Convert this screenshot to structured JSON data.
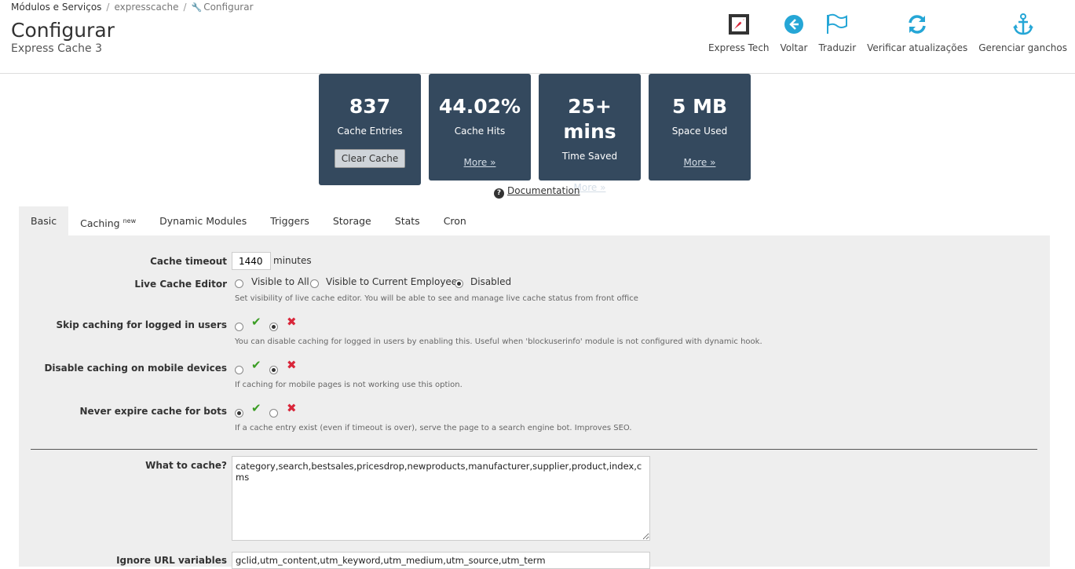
{
  "breadcrumb": {
    "first": "Módulos e Serviços",
    "second": "expresscache",
    "current": "Configurar"
  },
  "page": {
    "title": "Configurar",
    "subtitle": "Express Cache 3"
  },
  "toolbar": [
    {
      "label": "Express Tech",
      "icon": "rocket-icon"
    },
    {
      "label": "Voltar",
      "icon": "back-arrow-icon"
    },
    {
      "label": "Traduzir",
      "icon": "flag-icon"
    },
    {
      "label": "Verificar atualizações",
      "icon": "refresh-icon"
    },
    {
      "label": "Gerenciar ganchos",
      "icon": "anchor-icon"
    }
  ],
  "stats": [
    {
      "value": "837",
      "caption": "Cache Entries",
      "action": "Clear Cache"
    },
    {
      "value": "44.02%",
      "caption": "Cache Hits",
      "action": "More »"
    },
    {
      "value": "25+ mins",
      "caption": "Time Saved",
      "action": "More »"
    },
    {
      "value": "5 MB",
      "caption": "Space Used",
      "action": "More »"
    }
  ],
  "documentation": "Documentation",
  "tabs": [
    {
      "label": "Basic",
      "badge": ""
    },
    {
      "label": "Caching",
      "badge": "new"
    },
    {
      "label": "Dynamic Modules",
      "badge": ""
    },
    {
      "label": "Triggers",
      "badge": ""
    },
    {
      "label": "Storage",
      "badge": ""
    },
    {
      "label": "Stats",
      "badge": ""
    },
    {
      "label": "Cron",
      "badge": ""
    }
  ],
  "form": {
    "cache_timeout": {
      "label": "Cache timeout",
      "value": "1440",
      "suffix": "minutes"
    },
    "live_editor": {
      "label": "Live Cache Editor",
      "options": [
        "Visible to All",
        "Visible to Current Employee",
        "Disabled"
      ],
      "selected": "Disabled",
      "help": "Set visibility of live cache editor. You will be able to see and manage live cache status from front office"
    },
    "skip_logged": {
      "label": "Skip caching for logged in users",
      "selected": "no",
      "help": "You can disable caching for logged in users by enabling this. Useful when 'blockuserinfo' module is not configured with dynamic hook."
    },
    "disable_mobile": {
      "label": "Disable caching on mobile devices",
      "selected": "no",
      "help": "If caching for mobile pages is not working use this option."
    },
    "never_expire_bots": {
      "label": "Never expire cache for bots",
      "selected": "yes",
      "help": "If a cache entry exist (even if timeout is over), serve the page to a search engine bot. Improves SEO."
    },
    "what_to_cache": {
      "label": "What to cache?",
      "value": "category,search,bestsales,pricesdrop,newproducts,manufacturer,supplier,product,index,cms"
    },
    "ignore_url": {
      "label": "Ignore URL variables",
      "value": "gclid,utm_content,utm_keyword,utm_medium,utm_source,utm_term"
    }
  },
  "colors": {
    "stat_bg": "#34495e",
    "icon_blue": "#25a6d6",
    "check": "#3a9d23",
    "cross": "#d9263a"
  }
}
